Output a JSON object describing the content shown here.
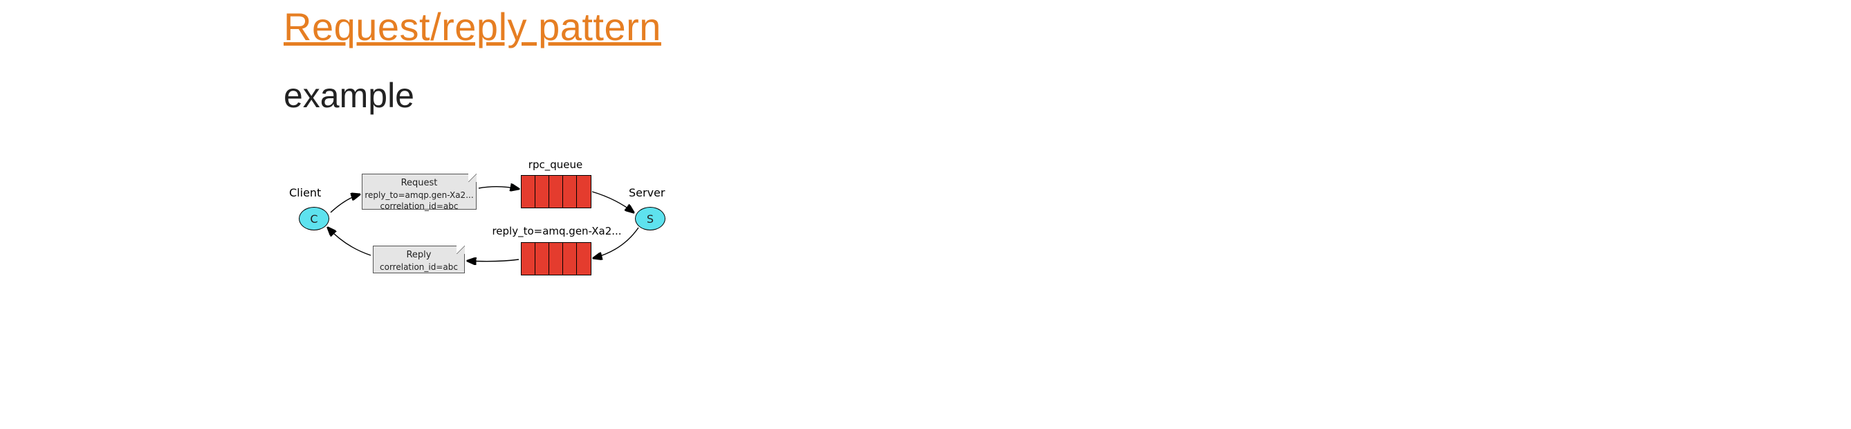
{
  "title": "Request/reply pattern",
  "subtitle": "example",
  "diagram": {
    "client": {
      "label": "Client",
      "letter": "C"
    },
    "server": {
      "label": "Server",
      "letter": "S"
    },
    "rpc_queue_label": "rpc_queue",
    "reply_queue_label": "reply_to=amq.gen-Xa2...",
    "request_note": {
      "title": "Request",
      "line1": "reply_to=amqp.gen-Xa2...",
      "line2": "correlation_id=abc"
    },
    "reply_note": {
      "title": "Reply",
      "line1": "correlation_id=abc"
    },
    "queue_slots": 5
  }
}
